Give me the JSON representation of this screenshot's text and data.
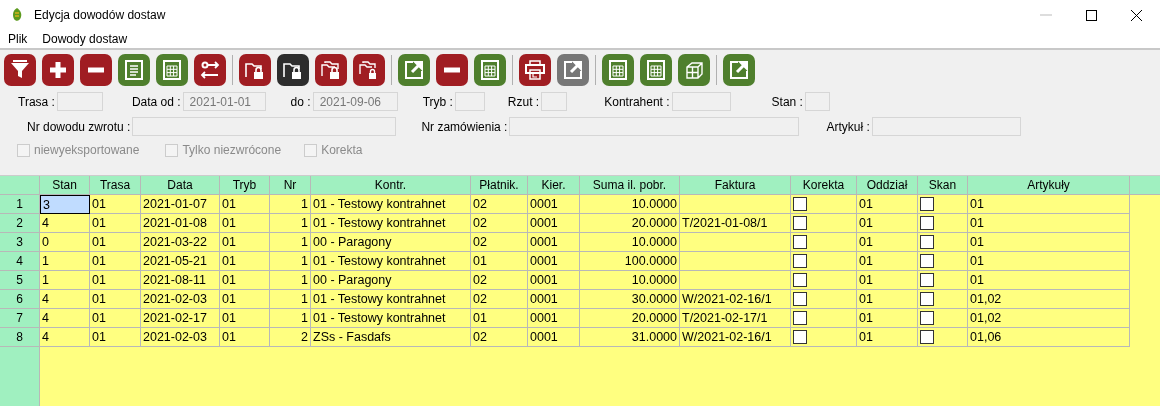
{
  "window": {
    "title": "Edycja dowodów dostaw"
  },
  "menu": [
    "Plik",
    "Dowody dostaw"
  ],
  "toolbar": [
    [
      {
        "kind": "filter",
        "color": "#a01d22"
      },
      {
        "kind": "plus",
        "color": "#a01d22"
      },
      {
        "kind": "minus",
        "color": "#a01d22"
      },
      {
        "kind": "document",
        "color": "#4f7f2d"
      },
      {
        "kind": "grid",
        "color": "#4f7f2d"
      },
      {
        "kind": "swap",
        "color": "#a01d22"
      }
    ],
    [
      {
        "kind": "folder-lock",
        "color": "#a01d22"
      },
      {
        "kind": "folder-lock",
        "color": "#2d2d2d"
      },
      {
        "kind": "folders-lock",
        "color": "#a01d22"
      },
      {
        "kind": "folders-lock-small",
        "color": "#a01d22"
      }
    ],
    [
      {
        "kind": "export",
        "color": "#4f7f2d"
      },
      {
        "kind": "minus",
        "color": "#a01d22"
      },
      {
        "kind": "grid",
        "color": "#4f7f2d"
      }
    ],
    [
      {
        "kind": "printer",
        "color": "#a01d22"
      },
      {
        "kind": "export",
        "color": "#777777"
      }
    ],
    [
      {
        "kind": "grid",
        "color": "#4f7f2d"
      },
      {
        "kind": "grid",
        "color": "#4f7f2d"
      },
      {
        "kind": "cube",
        "color": "#4f7f2d"
      }
    ],
    [
      {
        "kind": "export",
        "color": "#4f7f2d"
      }
    ]
  ],
  "filters_row1": [
    {
      "label": "Trasa :"
    },
    {
      "label": "Data od :",
      "value": "2021-01-01"
    },
    {
      "label": "do :",
      "value": "2021-09-06"
    },
    {
      "label": "Tryb :"
    },
    {
      "label": "Rzut :"
    },
    {
      "label": "Kontrahent :"
    },
    {
      "label": "Stan :"
    }
  ],
  "filters_row2": [
    {
      "label": "Nr dowodu zwrotu :"
    },
    {
      "label": "Nr zamówienia :"
    },
    {
      "label": "Artykuł :"
    }
  ],
  "options": [
    {
      "label": "niewyeksportowane",
      "checked": false,
      "disabled": true
    },
    {
      "label": "Tylko niezwrócone",
      "checked": false,
      "disabled": true
    },
    {
      "label": "Korekta",
      "checked": false,
      "disabled": true
    }
  ],
  "table": {
    "columns": [
      "Stan",
      "Trasa",
      "Data",
      "Tryb",
      "Nr",
      "Kontr.",
      "Płatnik.",
      "Kier.",
      "Suma il. pobr.",
      "Faktura",
      "Korekta",
      "Oddział",
      "Skan",
      "Artykuły"
    ],
    "rows": [
      {
        "number": "1",
        "selected": true,
        "stan": "3",
        "trasa": "01",
        "data": "2021-01-07",
        "tryb": "01",
        "nr": "1",
        "kontr": "01 - Testowy kontrahnet",
        "platnik": "02",
        "kier": "0001",
        "suma": "10.0000",
        "faktura": "",
        "korekta": false,
        "oddzial": "01",
        "skan": false,
        "artykuly": "01"
      },
      {
        "number": "2",
        "selected": false,
        "stan": "4",
        "trasa": "01",
        "data": "2021-01-08",
        "tryb": "01",
        "nr": "1",
        "kontr": "01 - Testowy kontrahnet",
        "platnik": "02",
        "kier": "0001",
        "suma": "20.0000",
        "faktura": "T/2021-01-08/1",
        "korekta": false,
        "oddzial": "01",
        "skan": false,
        "artykuly": "01"
      },
      {
        "number": "3",
        "selected": false,
        "stan": "0",
        "trasa": "01",
        "data": "2021-03-22",
        "tryb": "01",
        "nr": "1",
        "kontr": "00 - Paragony",
        "platnik": "02",
        "kier": "0001",
        "suma": "10.0000",
        "faktura": "",
        "korekta": false,
        "oddzial": "01",
        "skan": false,
        "artykuly": "01"
      },
      {
        "number": "4",
        "selected": false,
        "stan": "1",
        "trasa": "01",
        "data": "2021-05-21",
        "tryb": "01",
        "nr": "1",
        "kontr": "01 - Testowy kontrahnet",
        "platnik": "01",
        "kier": "0001",
        "suma": "100.0000",
        "faktura": "",
        "korekta": false,
        "oddzial": "01",
        "skan": false,
        "artykuly": "01"
      },
      {
        "number": "5",
        "selected": false,
        "stan": "1",
        "trasa": "01",
        "data": "2021-08-11",
        "tryb": "01",
        "nr": "1",
        "kontr": "00 - Paragony",
        "platnik": "02",
        "kier": "0001",
        "suma": "10.0000",
        "faktura": "",
        "korekta": false,
        "oddzial": "01",
        "skan": false,
        "artykuly": "01"
      },
      {
        "number": "6",
        "selected": false,
        "stan": "4",
        "trasa": "01",
        "data": "2021-02-03",
        "tryb": "01",
        "nr": "1",
        "kontr": "01 - Testowy kontrahnet",
        "platnik": "02",
        "kier": "0001",
        "suma": "30.0000",
        "faktura": "W/2021-02-16/1",
        "korekta": false,
        "oddzial": "01",
        "skan": false,
        "artykuly": "01,02"
      },
      {
        "number": "7",
        "selected": false,
        "stan": "4",
        "trasa": "01",
        "data": "2021-02-17",
        "tryb": "01",
        "nr": "1",
        "kontr": "01 - Testowy kontrahnet",
        "platnik": "01",
        "kier": "0001",
        "suma": "20.0000",
        "faktura": "T/2021-02-17/1",
        "korekta": false,
        "oddzial": "01",
        "skan": false,
        "artykuly": "01,02"
      },
      {
        "number": "8",
        "selected": false,
        "stan": "4",
        "trasa": "01",
        "data": "2021-02-03",
        "tryb": "01",
        "nr": "2",
        "kontr": "ZSs - Fasdafs",
        "platnik": "02",
        "kier": "0001",
        "suma": "31.0000",
        "faktura": "W/2021-02-16/1",
        "korekta": false,
        "oddzial": "01",
        "skan": false,
        "artykuly": "01,06"
      }
    ]
  }
}
